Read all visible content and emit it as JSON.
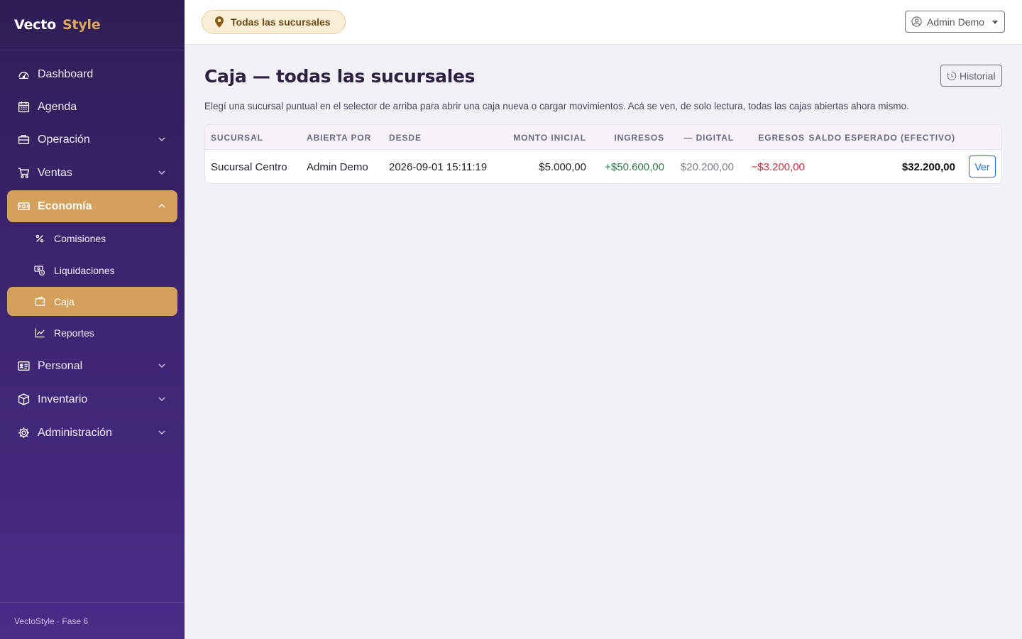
{
  "brand": {
    "part1": "Vecto",
    "part2": "Style"
  },
  "colors": {
    "sidebar_top": "#2e1d55",
    "sidebar_bottom": "#4a2b86",
    "accent": "#d4a15c",
    "positive": "#2e7d4a",
    "negative": "#d12c3a",
    "primary": "#0d6efd"
  },
  "sidebar": {
    "items": [
      {
        "label": "Dashboard",
        "icon": "gauge-icon"
      },
      {
        "label": "Agenda",
        "icon": "calendar-icon"
      },
      {
        "label": "Operación",
        "icon": "briefcase-icon",
        "expandable": true
      },
      {
        "label": "Ventas",
        "icon": "cart-icon",
        "expandable": true
      },
      {
        "label": "Economía",
        "icon": "cash-icon",
        "expandable": true,
        "expanded": true,
        "active": true
      },
      {
        "label": "Personal",
        "icon": "id-card-icon",
        "expandable": true
      },
      {
        "label": "Inventario",
        "icon": "box-icon",
        "expandable": true
      },
      {
        "label": "Administración",
        "icon": "gear-icon",
        "expandable": true
      }
    ],
    "economia_sub": [
      {
        "label": "Comisiones",
        "icon": "percent-icon"
      },
      {
        "label": "Liquidaciones",
        "icon": "coins-icon"
      },
      {
        "label": "Caja",
        "icon": "wallet-icon",
        "active": true
      },
      {
        "label": "Reportes",
        "icon": "chart-line-icon"
      }
    ],
    "footer": "VectoStyle · Fase 6"
  },
  "topbar": {
    "branch_selector": "Todas las sucursales",
    "user": "Admin Demo"
  },
  "main": {
    "title": "Caja — todas las sucursales",
    "history_button": "Historial",
    "subtitle": "Elegí una sucursal puntual en el selector de arriba para abrir una caja nueva o cargar movimientos. Acá se ven, de solo lectura, todas las cajas abiertas ahora mismo.",
    "table": {
      "headers": [
        "SUCURSAL",
        "ABIERTA POR",
        "DESDE",
        "MONTO INICIAL",
        "INGRESOS",
        "— DIGITAL",
        "EGRESOS",
        "SALDO ESPERADO (EFECTIVO)"
      ],
      "rows": [
        {
          "sucursal": "Sucursal Centro",
          "abierta_por": "Admin Demo",
          "desde": "2026-09-01 15:11:19",
          "monto_inicial": "$5.000,00",
          "ingresos": "+$50.600,00",
          "digital": "$20.200,00",
          "egresos": "−$3.200,00",
          "saldo": "$32.200,00",
          "action": "Ver"
        }
      ]
    }
  }
}
